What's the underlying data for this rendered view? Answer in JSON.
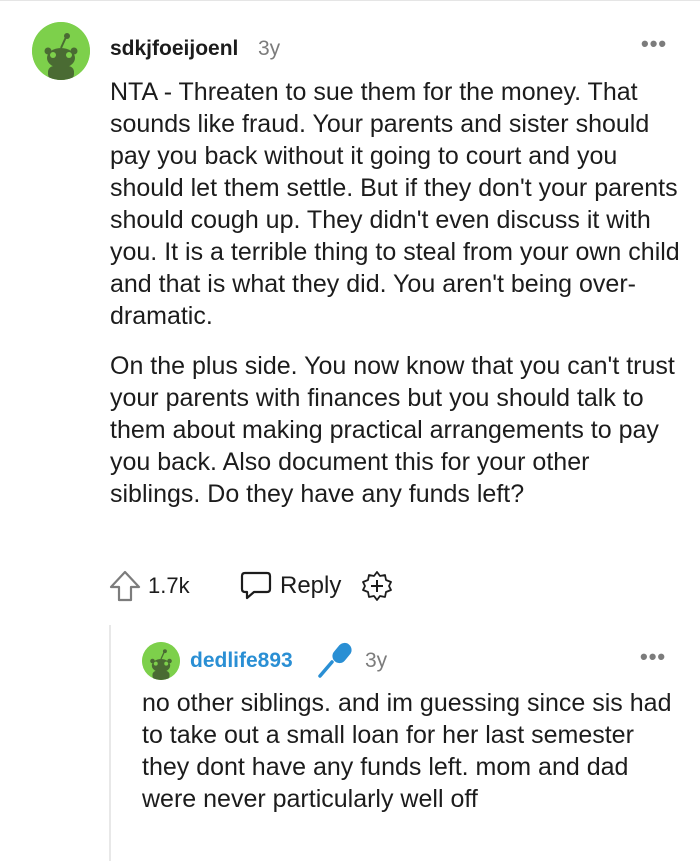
{
  "comment": {
    "username": "sdkjfoeijoenl",
    "age": "3y",
    "more_label": "•••",
    "paragraphs": [
      "NTA - Threaten to sue them for the money. That sounds like fraud. Your parents and sister should pay you back without it going to court and you should let them settle. But if they don't your parents should cough up. They didn't even discuss it with you. It is a terrible thing to steal from your own child and that is what they did. You aren't being over-dramatic.",
      "On the plus side. You now know that you can't trust your parents with finances but you should talk to them about making practical arrangements to pay you back. Also document this for your other siblings. Do they have any funds left?"
    ],
    "score": "1.7k",
    "reply_label": "Reply",
    "icons": [
      "avatar-snoo",
      "more-icon",
      "upvote-arrow-icon",
      "reply-bubble-icon",
      "award-plus-icon"
    ]
  },
  "reply": {
    "username": "dedlife893",
    "age": "3y",
    "more_label": "•••",
    "flair_icon": "microphone-icon",
    "text": "no other siblings. and im guessing since sis had to take out a small loan for her last semester they dont have any funds left. mom and dad were never particularly well off"
  },
  "colors": {
    "avatar_green": "#7dd04b",
    "reply_username_blue": "#2a8fd4",
    "mic_blue": "#2a8fd4",
    "meta_gray": "#7c7c7c"
  }
}
